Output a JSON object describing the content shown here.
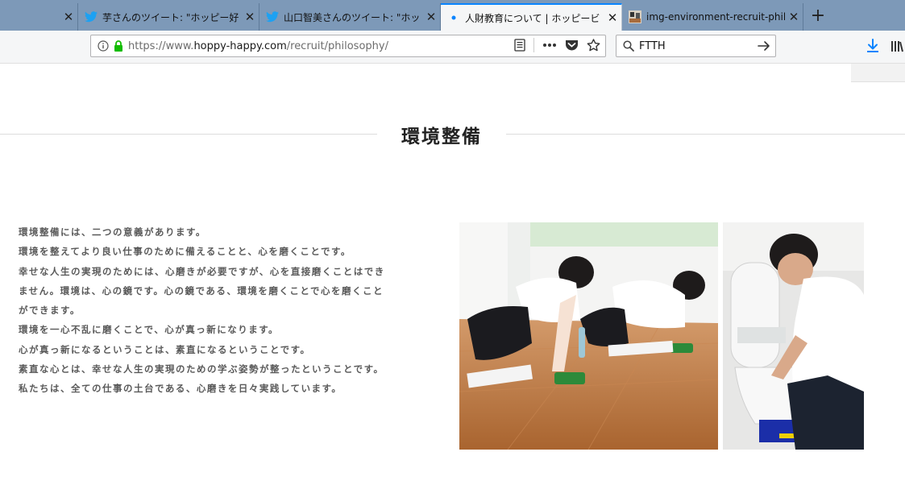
{
  "tabs": [
    {
      "title": "芋さんのツイート: \"ホッピー好",
      "icon": "twitter-bird-icon"
    },
    {
      "title": "山口智美さんのツイート: \"ホッ",
      "icon": "twitter-bird-icon"
    },
    {
      "title": "人財教育について | ホッピービ",
      "icon": "loading-dot-icon",
      "active": true
    },
    {
      "title": "img-environment-recruit-philo",
      "icon": "image-thumbnail-icon"
    }
  ],
  "url": {
    "prefix": "https://www.",
    "host": "hoppy-happy.com",
    "path": "/recruit/philosophy/"
  },
  "search": {
    "value": "FTTH"
  },
  "page": {
    "section_title": "環境整備",
    "paragraph": [
      "環境整備には、二つの意義があります。",
      "環境を整えてより良い仕事のために備えることと、心を磨くことです。",
      "幸せな人生の実現のためには、心磨きが必要ですが、心を直接磨くことはでき",
      "ません。環境は、心の鏡です。心の鏡である、環境を磨くことで心を磨くこと",
      "ができます。",
      "環境を一心不乱に磨くことで、心が真っ新になります。",
      "心が真っ新になるということは、素直になるということです。",
      "素直な心とは、幸せな人生の実現のための学ぶ姿勢が整ったということです。",
      "私たちは、全ての仕事の土台である、心磨きを日々実践しています。"
    ]
  },
  "colors": {
    "tabstrip": "#7d99b8",
    "accent": "#0a84ff",
    "lock": "#12bc00",
    "floor": "#b8713f"
  }
}
